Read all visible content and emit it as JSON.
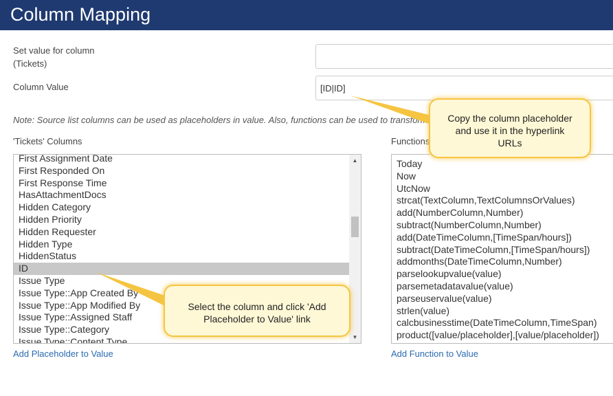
{
  "header": {
    "title": "Column Mapping"
  },
  "form": {
    "set_value_label_line1": "Set value for column",
    "set_value_label_line2": "(Tickets)",
    "set_value_input": "",
    "column_value_label": "Column Value",
    "column_value_input": "[ID|ID]",
    "note": "Note: Source list columns can be used as placeholders in value. Also, functions can be used to transform values."
  },
  "columns_panel": {
    "heading": "'Tickets' Columns",
    "items": [
      "First Assignment Date",
      "First Responded On",
      "First Response Time",
      "HasAttachmentDocs",
      "Hidden Category",
      "Hidden Priority",
      "Hidden Requester",
      "Hidden Type",
      "HiddenStatus",
      "ID",
      "Issue Type",
      "Issue Type::App Created By",
      "Issue Type::App Modified By",
      "Issue Type::Assigned Staff",
      "Issue Type::Category",
      "Issue Type::Content Type"
    ],
    "selected": "ID",
    "add_link": "Add Placeholder to Value"
  },
  "functions_panel": {
    "heading": "Functions",
    "items": [
      "Today",
      "Now",
      "UtcNow",
      "strcat(TextColumn,TextColumnsOrValues)",
      "add(NumberColumn,Number)",
      "subtract(NumberColumn,Number)",
      "add(DateTimeColumn,[TimeSpan/hours])",
      "subtract(DateTimeColumn,[TimeSpan/hours])",
      "addmonths(DateTimeColumn,Number)",
      "parselookupvalue(value)",
      "parsemetadatavalue(value)",
      "parseuservalue(value)",
      "strlen(value)",
      "calcbusinesstime(DateTimeColumn,TimeSpan)",
      "product([value/placeholder],[value/placeholder])"
    ],
    "add_link": "Add Function to Value"
  },
  "callouts": {
    "copy_line1": "Copy the column placeholder",
    "copy_line2": "and use it in the hyperlink",
    "copy_line3": "URLs",
    "select_line1": "Select the column and click 'Add",
    "select_line2": "Placeholder to Value' link"
  },
  "icons": {
    "scroll_up": "triangle-up-icon",
    "scroll_down": "triangle-down-icon"
  },
  "colors": {
    "header_bg": "#1f3a70",
    "link": "#2a6bb0",
    "callout_border": "#f5c542",
    "selection": "#c8c8c8"
  }
}
